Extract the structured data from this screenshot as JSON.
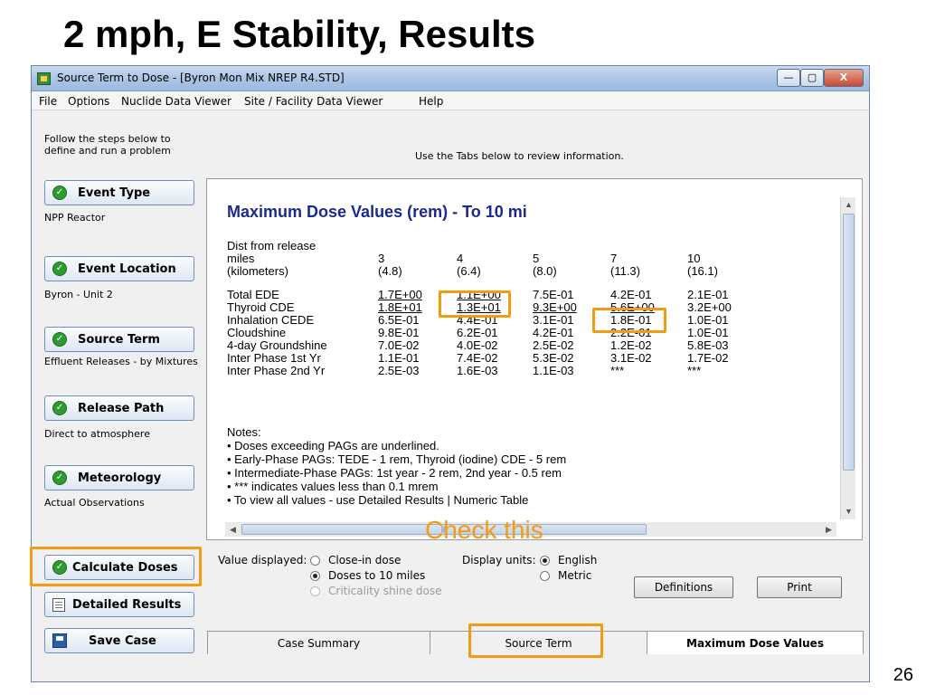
{
  "slide": {
    "title": "2 mph, E Stability, Results",
    "page_number": "26"
  },
  "window": {
    "title": "Source Term to Dose - [Byron Mon Mix NREP R4.STD]",
    "controls": {
      "minimize": "—",
      "maximize": "▢",
      "close": "X"
    }
  },
  "menu": [
    "File",
    "Options",
    "Nuclide Data Viewer",
    "Site / Facility Data Viewer",
    "Help"
  ],
  "left_panel": {
    "instruction": "Follow the steps below to define and run a problem",
    "steps": [
      {
        "label": "Event Type",
        "description": "NPP Reactor"
      },
      {
        "label": "Event Location",
        "description": "Byron - Unit 2"
      },
      {
        "label": "Source Term",
        "description": "Effluent Releases - by Mixtures"
      },
      {
        "label": "Release Path",
        "description": "Direct to atmosphere"
      },
      {
        "label": "Meteorology",
        "description": "Actual Observations"
      }
    ],
    "calculate_label": "Calculate Doses",
    "detailed_label": "Detailed Results",
    "save_label": "Save Case"
  },
  "review_note": "Use the Tabs below to review information.",
  "report": {
    "title": "Maximum Dose Values (rem) - To 10 mi",
    "header_rows": [
      [
        "Dist from release",
        "",
        "",
        "",
        "",
        ""
      ],
      [
        " miles",
        "3",
        "4",
        "5",
        "7",
        "10"
      ],
      [
        " (kilometers)",
        "(4.8)",
        "(6.4)",
        "(8.0)",
        "(11.3)",
        "(16.1)"
      ]
    ],
    "rows": [
      {
        "name": "Total EDE",
        "values": [
          "1.7E+00",
          "1.1E+00",
          "7.5E-01",
          "4.2E-01",
          "2.1E-01"
        ],
        "underlined": [
          true,
          true,
          false,
          false,
          false
        ]
      },
      {
        "name": "Thyroid CDE",
        "values": [
          "1.8E+01",
          "1.3E+01",
          "9.3E+00",
          "5.6E+00",
          "3.2E+00"
        ],
        "underlined": [
          true,
          true,
          true,
          true,
          false
        ]
      },
      {
        "name": "Inhalation CEDE",
        "values": [
          "6.5E-01",
          "4.4E-01",
          "3.1E-01",
          "1.8E-01",
          "1.0E-01"
        ],
        "underlined": [
          false,
          false,
          false,
          false,
          false
        ]
      },
      {
        "name": "Cloudshine",
        "values": [
          "9.8E-01",
          "6.2E-01",
          "4.2E-01",
          "2.2E-01",
          "1.0E-01"
        ],
        "underlined": [
          false,
          false,
          false,
          false,
          false
        ]
      },
      {
        "name": "4-day Groundshine",
        "values": [
          "7.0E-02",
          "4.0E-02",
          "2.5E-02",
          "1.2E-02",
          "5.8E-03"
        ],
        "underlined": [
          false,
          false,
          false,
          false,
          false
        ]
      },
      {
        "name": "Inter Phase 1st Yr",
        "values": [
          "1.1E-01",
          "7.4E-02",
          "5.3E-02",
          "3.1E-02",
          "1.7E-02"
        ],
        "underlined": [
          false,
          false,
          false,
          false,
          false
        ]
      },
      {
        "name": "Inter Phase 2nd Yr",
        "values": [
          "2.5E-03",
          "1.6E-03",
          "1.1E-03",
          " ***",
          " ***"
        ],
        "underlined": [
          false,
          false,
          false,
          false,
          false
        ]
      }
    ],
    "notes": [
      "Notes:",
      "• Doses exceeding PAGs are underlined.",
      "• Early-Phase PAGs: TEDE - 1 rem, Thyroid (iodine) CDE - 5 rem",
      "• Intermediate-Phase PAGs: 1st year - 2 rem, 2nd year - 0.5 rem",
      "• *** indicates values less than 0.1 mrem",
      "• To view all values - use Detailed Results | Numeric Table"
    ]
  },
  "options": {
    "value_label": "Value displayed:",
    "value_options": [
      {
        "label": "Close-in dose",
        "selected": false,
        "enabled": true
      },
      {
        "label": "Doses to 10 miles",
        "selected": true,
        "enabled": true
      },
      {
        "label": "Criticality shine dose",
        "selected": false,
        "enabled": false
      }
    ],
    "units_label": "Display units:",
    "unit_options": [
      {
        "label": "English",
        "selected": true
      },
      {
        "label": "Metric",
        "selected": false
      }
    ]
  },
  "buttons": {
    "definitions": "Definitions",
    "print": "Print"
  },
  "annotation": {
    "check_this": "Check this",
    "color": "#f39c12"
  },
  "tabs": [
    {
      "label": "Case Summary",
      "active": false
    },
    {
      "label": "Source Term",
      "active": false
    },
    {
      "label": "Maximum Dose Values",
      "active": true
    }
  ]
}
